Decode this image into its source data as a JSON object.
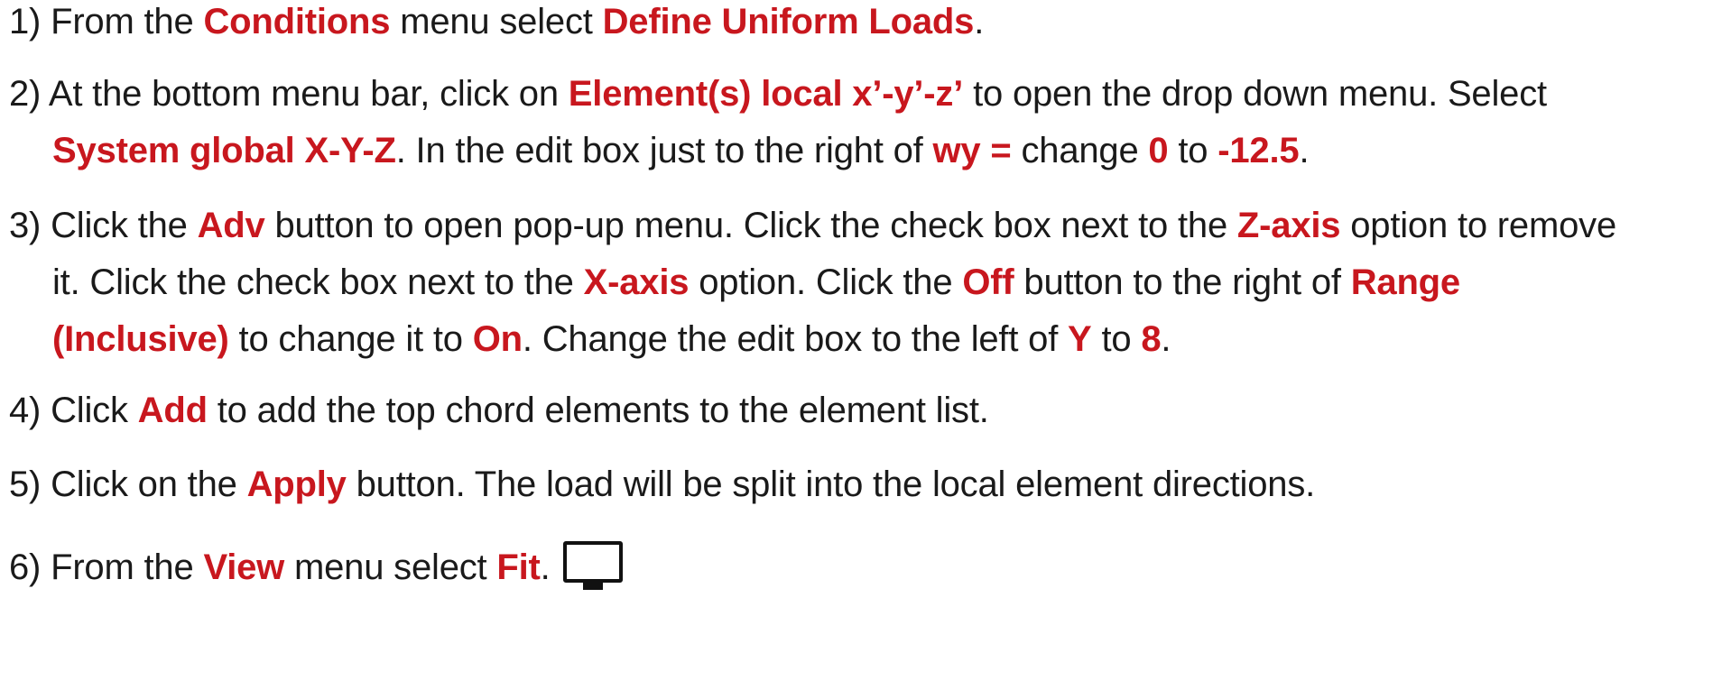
{
  "steps": [
    {
      "lines": [
        [
          {
            "t": "1) From the "
          },
          {
            "t": "Conditions",
            "h": true
          },
          {
            "t": " menu select "
          },
          {
            "t": "Define Uniform Loads",
            "h": true
          },
          {
            "t": "."
          }
        ]
      ]
    },
    {
      "lines": [
        [
          {
            "t": "2) At the bottom menu bar, click on "
          },
          {
            "t": "Element(s) local x’-y’-z’",
            "h": true
          },
          {
            "t": " to open the drop down menu. Select"
          }
        ],
        [
          {
            "t": "System global X-Y-Z",
            "h": true
          },
          {
            "t": ". In the edit box just to the right of "
          },
          {
            "t": "wy =",
            "h": true
          },
          {
            "t": " change "
          },
          {
            "t": "0",
            "h": true
          },
          {
            "t": " to "
          },
          {
            "t": "-12.5",
            "h": true
          },
          {
            "t": "."
          }
        ]
      ]
    },
    {
      "lines": [
        [
          {
            "t": "3) Click the "
          },
          {
            "t": "Adv",
            "h": true
          },
          {
            "t": " button to open pop-up menu. Click the check box next to the "
          },
          {
            "t": "Z-axis",
            "h": true
          },
          {
            "t": " option to remove"
          }
        ],
        [
          {
            "t": "it. Click the check box next to the "
          },
          {
            "t": "X-axis",
            "h": true
          },
          {
            "t": " option. Click the "
          },
          {
            "t": "Off",
            "h": true
          },
          {
            "t": " button to the right of "
          },
          {
            "t": "Range",
            "h": true
          }
        ],
        [
          {
            "t": "(Inclusive)",
            "h": true
          },
          {
            "t": " to change it to "
          },
          {
            "t": "On",
            "h": true
          },
          {
            "t": ". Change the edit box to the left of "
          },
          {
            "t": "Y",
            "h": true
          },
          {
            "t": " to "
          },
          {
            "t": "8",
            "h": true
          },
          {
            "t": "."
          }
        ]
      ]
    },
    {
      "lines": [
        [
          {
            "t": "4) Click "
          },
          {
            "t": "Add",
            "h": true
          },
          {
            "t": " to add the top chord elements to the element list."
          }
        ]
      ]
    },
    {
      "lines": [
        [
          {
            "t": "5) Click on the "
          },
          {
            "t": "Apply",
            "h": true
          },
          {
            "t": " button. The load will be split into the local element directions."
          }
        ]
      ]
    },
    {
      "lines": [
        [
          {
            "t": "6) From the "
          },
          {
            "t": "View",
            "h": true
          },
          {
            "t": " menu select "
          },
          {
            "t": "Fit",
            "h": true
          },
          {
            "t": "."
          }
        ]
      ],
      "icon": "monitor-icon"
    }
  ],
  "colors": {
    "text": "#1a1a1a",
    "highlight": "#c8171e",
    "background": "#ffffff"
  }
}
